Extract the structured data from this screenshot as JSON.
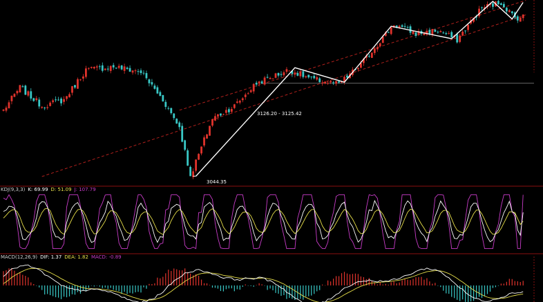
{
  "colors": {
    "background": "#000000",
    "up_candle": "#e0332c",
    "down_candle": "#39c8c6",
    "trend_line": "#ffffff",
    "channel": "#b0201c",
    "hline": "#8a8a8a",
    "kdj_k": "#ffffff",
    "kdj_d": "#e8e04a",
    "kdj_j": "#c83cc8",
    "macd_dif": "#ffffff",
    "macd_dea": "#e8e04a",
    "separator": "#8b1010"
  },
  "annotations": {
    "low_label": "3044.35",
    "mid_label": "3126.20 - 3125.42"
  },
  "kdj": {
    "name": "KDJ(9,3,3)",
    "k": "K: 69.99",
    "d": "D: 51.09",
    "j": "J: 107.79"
  },
  "macd": {
    "name": "MACD(12,26,9)",
    "dif": "DIF: 1.37",
    "dea": "DEA: 1.82",
    "macd": "MACD: -0.89"
  },
  "chart_data": [
    {
      "type": "candlestick",
      "title": "",
      "price_key_points": [
        {
          "idx": 0,
          "close": 3108
        },
        {
          "idx": 6,
          "close": 3130
        },
        {
          "idx": 14,
          "close": 3112
        },
        {
          "idx": 22,
          "close": 3118
        },
        {
          "idx": 30,
          "close": 3147
        },
        {
          "idx": 40,
          "close": 3150
        },
        {
          "idx": 50,
          "close": 3145
        },
        {
          "idx": 58,
          "close": 3118
        },
        {
          "idx": 64,
          "close": 3092
        },
        {
          "idx": 68,
          "close": 3044.35
        },
        {
          "idx": 76,
          "close": 3100
        },
        {
          "idx": 84,
          "close": 3112
        },
        {
          "idx": 92,
          "close": 3134
        },
        {
          "idx": 104,
          "close": 3147
        },
        {
          "idx": 112,
          "close": 3138
        },
        {
          "idx": 122,
          "close": 3133
        },
        {
          "idx": 130,
          "close": 3152
        },
        {
          "idx": 142,
          "close": 3191
        },
        {
          "idx": 150,
          "close": 3182
        },
        {
          "idx": 158,
          "close": 3185
        },
        {
          "idx": 165,
          "close": 3176
        },
        {
          "idx": 174,
          "close": 3207
        },
        {
          "idx": 181,
          "close": 3212
        },
        {
          "idx": 186,
          "close": 3197
        }
      ],
      "marked_values": [
        3044.35,
        3126.2,
        3125.42
      ],
      "reference_level": 3134,
      "trend_points": [
        {
          "idx": 70,
          "price": 3044.35
        },
        {
          "idx": 106,
          "price": 3149
        },
        {
          "idx": 124,
          "price": 3135
        },
        {
          "idx": 141,
          "price": 3189
        },
        {
          "idx": 163,
          "price": 3177
        },
        {
          "idx": 178,
          "price": 3213
        },
        {
          "idx": 185,
          "price": 3196
        },
        {
          "idx": 189,
          "price": 3212
        }
      ],
      "channel_upper": [
        {
          "idx": 64,
          "price": 3108
        },
        {
          "idx": 190,
          "price": 3214
        }
      ],
      "channel_lower": [
        {
          "idx": 14,
          "price": 3044
        },
        {
          "idx": 190,
          "price": 3200
        }
      ],
      "ylim": [
        3040,
        3213
      ],
      "candle_count": 190
    },
    {
      "type": "line",
      "title": "KDJ(9,3,3)",
      "series_names": [
        "K",
        "D",
        "J"
      ],
      "latest": {
        "K": 69.99,
        "D": 51.09,
        "J": 107.79
      },
      "ylim": [
        -10,
        110
      ]
    },
    {
      "type": "bar",
      "title": "MACD(12,26,9)",
      "series_names": [
        "DIF",
        "DEA",
        "MACD"
      ],
      "latest": {
        "DIF": 1.37,
        "DEA": 1.82,
        "MACD": -0.89
      }
    }
  ]
}
